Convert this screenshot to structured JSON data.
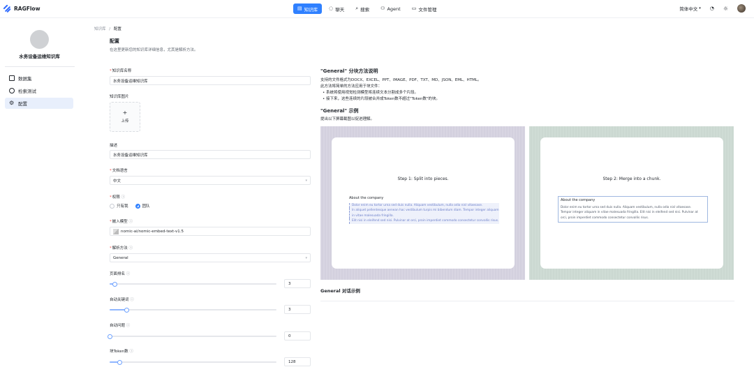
{
  "app": {
    "name": "RAGFlow"
  },
  "nav": {
    "items": [
      {
        "label": "知识库",
        "icon": "book-icon",
        "active": true
      },
      {
        "label": "聊天",
        "icon": "chat-icon",
        "active": false
      },
      {
        "label": "搜索",
        "icon": "search-icon",
        "active": false
      },
      {
        "label": "Agent",
        "icon": "agent-icon",
        "active": false
      },
      {
        "label": "文件管理",
        "icon": "file-icon",
        "active": false
      }
    ],
    "language": "简体中文",
    "accent": "#2f80ff"
  },
  "sidebar": {
    "kb_name": "水务设备运维知识库",
    "items": [
      {
        "label": "数据集",
        "icon": "dataset-icon",
        "active": false
      },
      {
        "label": "检索测试",
        "icon": "retrieval-test-icon",
        "active": false
      },
      {
        "label": "配置",
        "icon": "gear-icon",
        "active": true
      }
    ]
  },
  "breadcrumb": {
    "parent": "知识库",
    "sep": "/",
    "current": "配置"
  },
  "page": {
    "title": "配置",
    "subtitle": "在这里更新您的知识库详细信息，尤其是解析方法。"
  },
  "form": {
    "kb_name_label": "知识库名称",
    "kb_name_value": "水务设备运维知识库",
    "kb_image_label": "知识库图片",
    "upload_label": "上传",
    "desc_label": "描述",
    "desc_value": "水务设备运维知识库",
    "lang_label": "文档语言",
    "lang_value": "中文",
    "perm_label": "权限",
    "perm_options": [
      "只有我",
      "团队"
    ],
    "perm_selected": "团队",
    "embed_label": "嵌入模型",
    "embed_value": "nomic-ai/nomic-embed-text-v1.5",
    "parse_label": "解析方法",
    "parse_value": "General",
    "page_rank_label": "页面排名",
    "page_rank_value": "3",
    "page_rank_fraction": 0.03,
    "auto_kw_label": "自动关键词",
    "auto_kw_value": "3",
    "auto_kw_fraction": 0.1,
    "auto_q_label": "自动问题",
    "auto_q_value": "0",
    "auto_q_fraction": 0.0,
    "chunk_token_label": "块Token数",
    "chunk_token_value": "128",
    "chunk_token_fraction": 0.06
  },
  "info": {
    "method_title": "\"General\" 分块方法说明",
    "formats": "支持的文件格式为DOCX、EXCEL、PPT、IMAGE、PDF、TXT、MD、JSON、EML、HTML。",
    "intro": "此方法将简单的方法应用于块文件：",
    "bullet1": "系统将使用视觉检测模型将连续文本分割成多个片段。",
    "bullet2": "接下来，这些连续的片段被合并成Token数不超过\"Token数\"的块。",
    "example_title": "\"General\" 示例",
    "example_hint": "提出以下屏幕截图以促进理解。",
    "step1": "Step 1: Split into pieces.",
    "step2": "Step 2: Merge into a chunk.",
    "block_title": "About the company",
    "block_lines": [
      "Dolor enim eu tortor urna sed duis nulla. Aliquam vestibulum, nulla odio nisl vitaesase.",
      "In aliquet pellentesque aenean hac vestibulum turpis mi bibendum diam. Tempor integer aliquam in vitae malesuada fringilla.",
      "Elit nisi in eleifend sed nisi. Pulvinar at orci, proin imperdiet commodo consectetur convallis risus.",
      "Tempor integer aliquam in vitae malesuada fringilla. Elit nisi in eleifend sed nisi. Pulvinar at orci, proin imperdiet commodo consectetur convallis risus."
    ],
    "dialog_title": "General 对话示例"
  }
}
